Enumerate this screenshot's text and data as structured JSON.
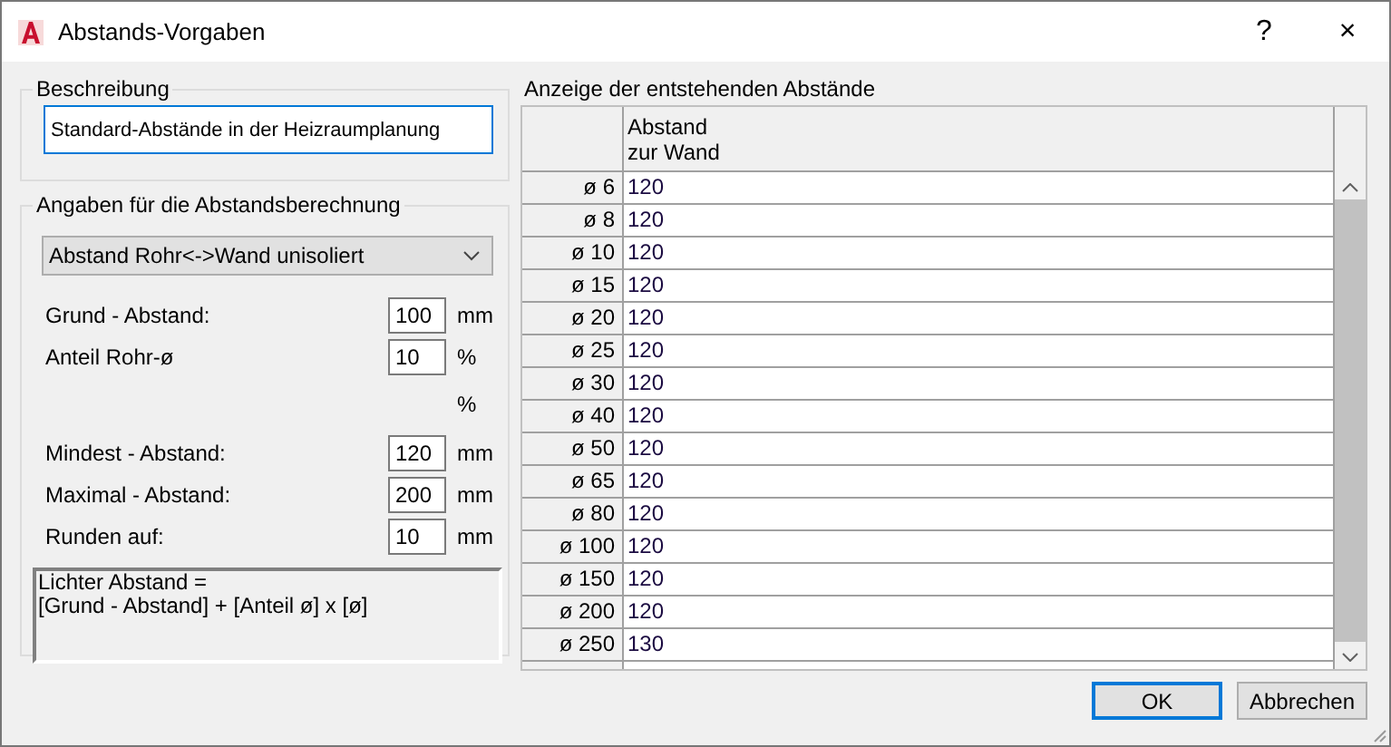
{
  "window": {
    "title": "Abstands-Vorgaben",
    "help": "?",
    "close": "×"
  },
  "description": {
    "label": "Beschreibung",
    "value": "Standard-Abstände in der Heizraumplanung"
  },
  "calculation": {
    "label": "Angaben für die Abstandsberechnung",
    "dropdown": "Abstand Rohr<->Wand unisoliert",
    "fields": [
      {
        "kind": "input",
        "label": "Grund - Abstand:",
        "value": "100",
        "unit": "mm"
      },
      {
        "kind": "input",
        "label": "Anteil Rohr-ø",
        "value": "10",
        "unit": "%"
      },
      {
        "kind": "unit",
        "unit": "%"
      },
      {
        "kind": "input",
        "label": "Mindest - Abstand:",
        "value": "120",
        "unit": "mm"
      },
      {
        "kind": "input",
        "label": "Maximal - Abstand:",
        "value": "200",
        "unit": "mm"
      },
      {
        "kind": "input",
        "label": "Runden auf:",
        "value": "10",
        "unit": "mm"
      }
    ],
    "formula": [
      "Lichter Abstand =",
      "[Grund - Abstand] + [Anteil ø] x [ø]"
    ]
  },
  "grid": {
    "title": "Anzeige der entstehenden Abstände",
    "column_header": [
      "Abstand",
      "zur Wand"
    ],
    "rows": [
      {
        "label": "ø 6",
        "value": "120"
      },
      {
        "label": "ø 8",
        "value": "120"
      },
      {
        "label": "ø 10",
        "value": "120"
      },
      {
        "label": "ø 15",
        "value": "120"
      },
      {
        "label": "ø 20",
        "value": "120"
      },
      {
        "label": "ø 25",
        "value": "120"
      },
      {
        "label": "ø 30",
        "value": "120"
      },
      {
        "label": "ø 40",
        "value": "120"
      },
      {
        "label": "ø 50",
        "value": "120"
      },
      {
        "label": "ø 65",
        "value": "120"
      },
      {
        "label": "ø 80",
        "value": "120"
      },
      {
        "label": "ø 100",
        "value": "120"
      },
      {
        "label": "ø 150",
        "value": "120"
      },
      {
        "label": "ø 200",
        "value": "120"
      },
      {
        "label": "ø 250",
        "value": "130"
      }
    ]
  },
  "buttons": [
    {
      "label": "OK",
      "default": true
    },
    {
      "label": "Abbrechen",
      "default": false
    }
  ]
}
